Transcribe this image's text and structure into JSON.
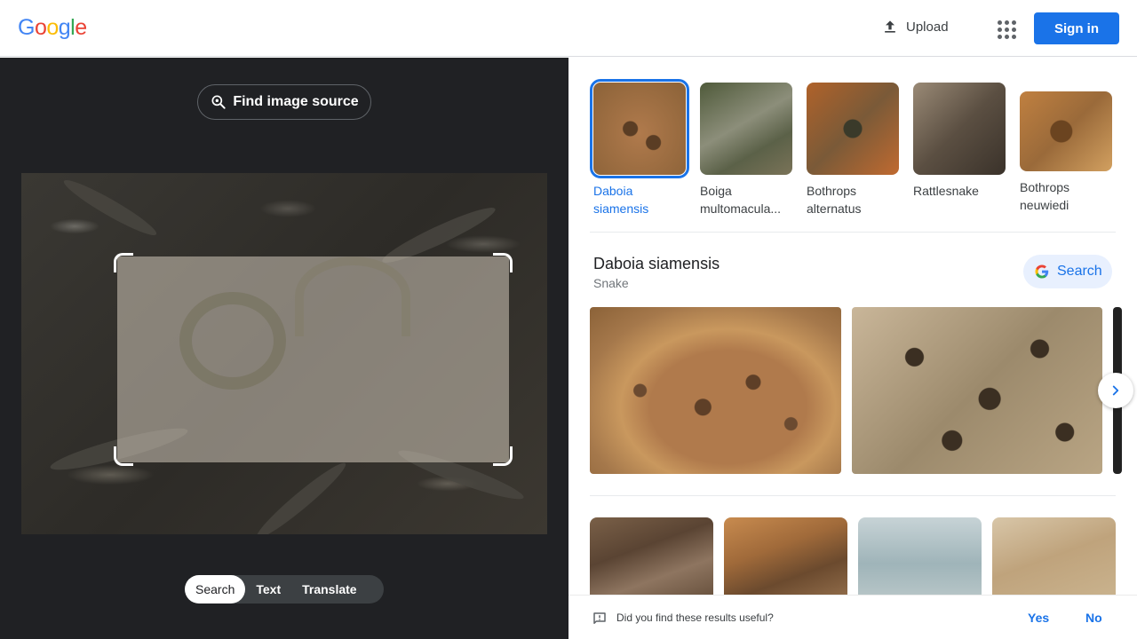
{
  "header": {
    "logo_letters": [
      "G",
      "o",
      "o",
      "g",
      "l",
      "e"
    ],
    "logo_colors": [
      "#4285F4",
      "#EA4335",
      "#FBBC05",
      "#4285F4",
      "#34A853",
      "#EA4335"
    ],
    "upload_label": "Upload",
    "signin_label": "Sign in"
  },
  "left": {
    "find_source_label": "Find image source",
    "modes": [
      {
        "label": "Search",
        "active": true
      },
      {
        "label": "Text",
        "active": false
      },
      {
        "label": "Translate",
        "active": false
      }
    ]
  },
  "right": {
    "thumbnails": [
      {
        "label": "Daboia siamensis",
        "selected": true,
        "color": "#a6754a"
      },
      {
        "label": "Boiga multomacula...",
        "selected": false,
        "color": "#6b6e56"
      },
      {
        "label": "Bothrops alternatus",
        "selected": false,
        "color": "#8a5a34"
      },
      {
        "label": "Rattlesnake",
        "selected": false,
        "color": "#7b6a58"
      },
      {
        "label": "Bothrops neuwiedi",
        "selected": false,
        "color": "#9c6e3e"
      }
    ],
    "entity": {
      "title": "Daboia siamensis",
      "subtitle": "Snake",
      "search_label": "Search"
    },
    "feedback": {
      "question": "Did you find these results useful?",
      "yes": "Yes",
      "no": "No"
    }
  },
  "colors": {
    "accent": "#1a73e8",
    "dark_pane": "#202124"
  }
}
